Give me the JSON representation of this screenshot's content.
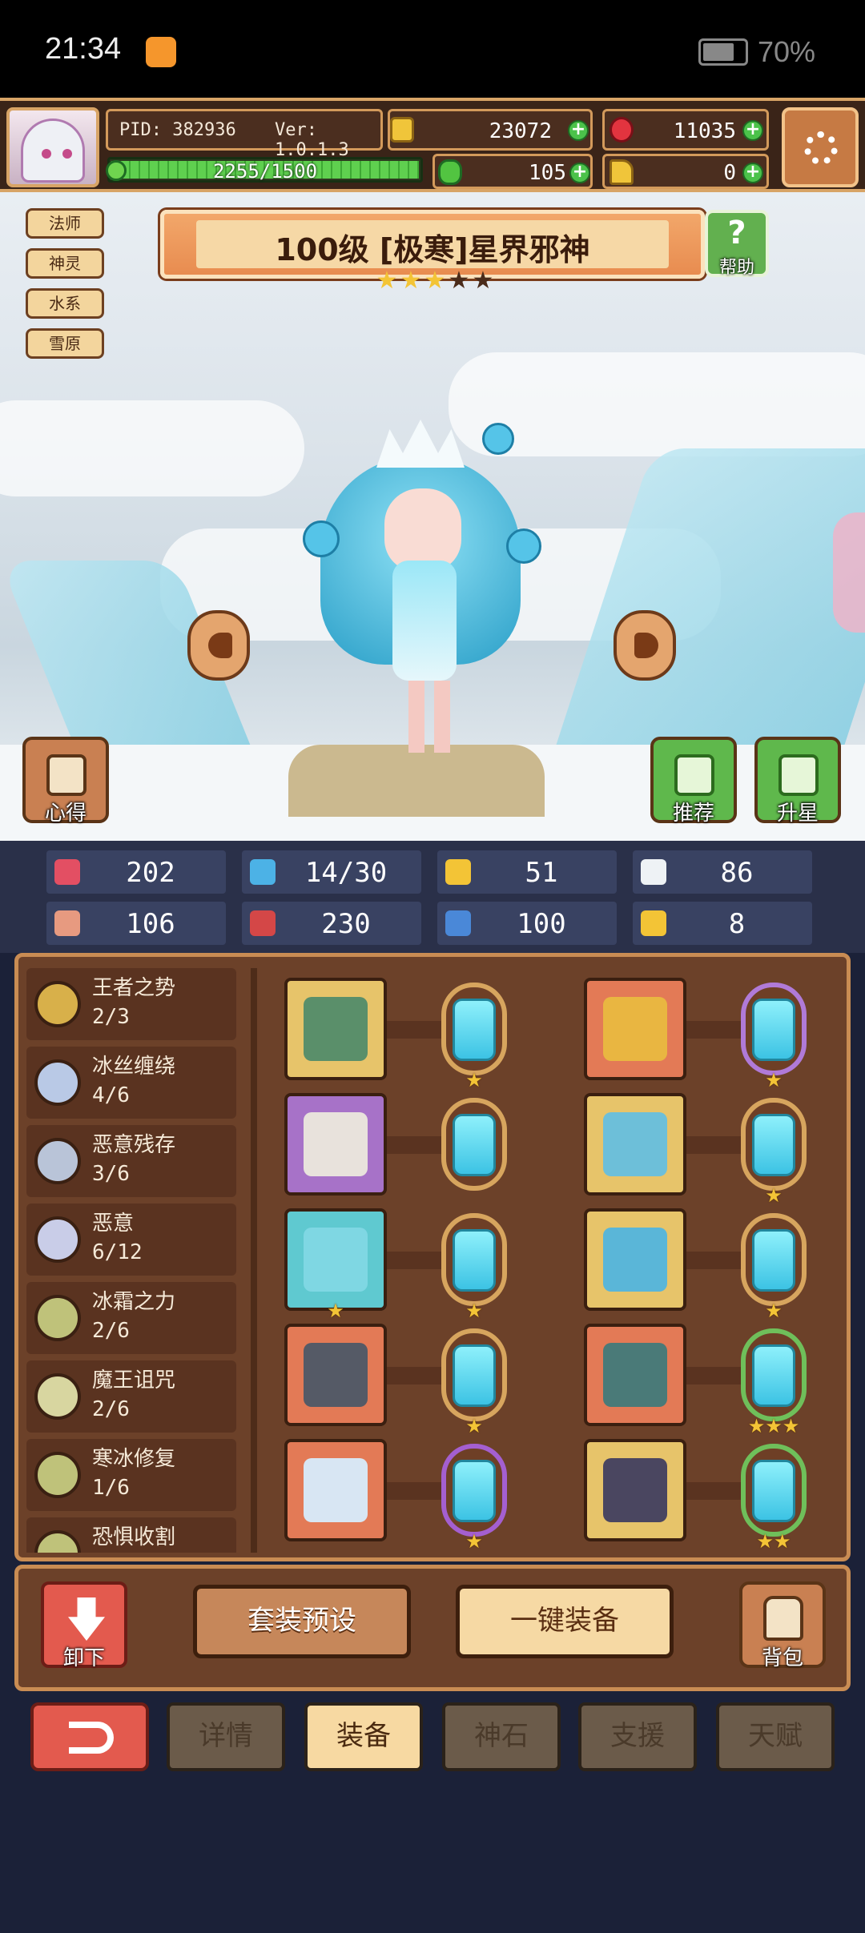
{
  "status_bar": {
    "time": "21:34",
    "battery": "70%"
  },
  "header": {
    "pid": "PID: 382936",
    "version": "Ver: 1.0.1.3",
    "gold": "23072",
    "gems": "11035",
    "xp": "2255/1500",
    "xp_progress": 1.0,
    "clover": "105",
    "key": "0"
  },
  "hero": {
    "tags": [
      "法师",
      "神灵",
      "水系",
      "雪原"
    ],
    "title": "100级 [极寒]星界邪神",
    "stars_filled": 3,
    "stars_total": 5,
    "help_label": "帮助",
    "left_button_label": "心得",
    "recommend_label": "推荐",
    "upgrade_label": "升星"
  },
  "stats": [
    {
      "icon": "heart-icon",
      "value": "202"
    },
    {
      "icon": "water-drop-icon",
      "value": "14/30"
    },
    {
      "icon": "shield-icon",
      "value": "51"
    },
    {
      "icon": "feather-icon",
      "value": "86"
    },
    {
      "icon": "fist-icon",
      "value": "106"
    },
    {
      "icon": "book-icon",
      "value": "230"
    },
    {
      "icon": "boot-icon",
      "value": "100"
    },
    {
      "icon": "magnet-icon",
      "value": "8"
    }
  ],
  "sets": [
    {
      "name": "王者之势",
      "count": "2/3",
      "color": "#d8b04a"
    },
    {
      "name": "冰丝缠绕",
      "count": "4/6",
      "color": "#b9c9e6"
    },
    {
      "name": "恶意残存",
      "count": "3/6",
      "color": "#b9c4d8"
    },
    {
      "name": "恶意",
      "count": "6/12",
      "color": "#c9cde8"
    },
    {
      "name": "冰霜之力",
      "count": "2/6",
      "color": "#bfc27a"
    },
    {
      "name": "魔王诅咒",
      "count": "2/6",
      "color": "#d8d6a0"
    },
    {
      "name": "寒冰修复",
      "count": "1/6",
      "color": "#bfc27a"
    },
    {
      "name": "恐惧收割",
      "count": "",
      "color": "#bfc27a"
    }
  ],
  "equipment": [
    {
      "slot": "weapon",
      "bg": "#e7c46a",
      "gem_border": "#d7a55e",
      "gem_stars": "★",
      "item_stars": ""
    },
    {
      "slot": "hat",
      "bg": "#e37a56",
      "gem_border": "#b07ad8",
      "gem_stars": "★",
      "item_stars": ""
    },
    {
      "slot": "cape",
      "bg": "#a772c8",
      "gem_border": "#d7a55e",
      "gem_stars": "",
      "item_stars": ""
    },
    {
      "slot": "armor",
      "bg": "#e7c46a",
      "gem_border": "#d7a55e",
      "gem_stars": "★",
      "item_stars": ""
    },
    {
      "slot": "necklace",
      "bg": "#5fc9d0",
      "gem_border": "#d7a55e",
      "gem_stars": "★",
      "item_stars": "★"
    },
    {
      "slot": "gloves",
      "bg": "#e7c46a",
      "gem_border": "#d7a55e",
      "gem_stars": "★",
      "item_stars": ""
    },
    {
      "slot": "ore",
      "bg": "#e37a56",
      "gem_border": "#d7a55e",
      "gem_stars": "★",
      "item_stars": ""
    },
    {
      "slot": "belt",
      "bg": "#e37a56",
      "gem_border": "#6fbf5a",
      "gem_stars": "★★★",
      "item_stars": ""
    },
    {
      "slot": "ring",
      "bg": "#e37a56",
      "gem_border": "#a45fd0",
      "gem_stars": "★",
      "item_stars": ""
    },
    {
      "slot": "boots",
      "bg": "#e7c46a",
      "gem_border": "#6fbf5a",
      "gem_stars": "★★",
      "item_stars": ""
    }
  ],
  "actions": {
    "unequip": "卸下",
    "preset": "套装预设",
    "auto_equip": "一键装备",
    "bag": "背包"
  },
  "tabs": [
    "详情",
    "装备",
    "神石",
    "支援",
    "天赋"
  ],
  "active_tab": "装备",
  "colors": {
    "accent_gold": "#d8a466",
    "panel_brown": "#6c4129",
    "stat_bg": "#394262",
    "tab_active": "#f7d9a2",
    "back_red": "#e35a4e"
  }
}
